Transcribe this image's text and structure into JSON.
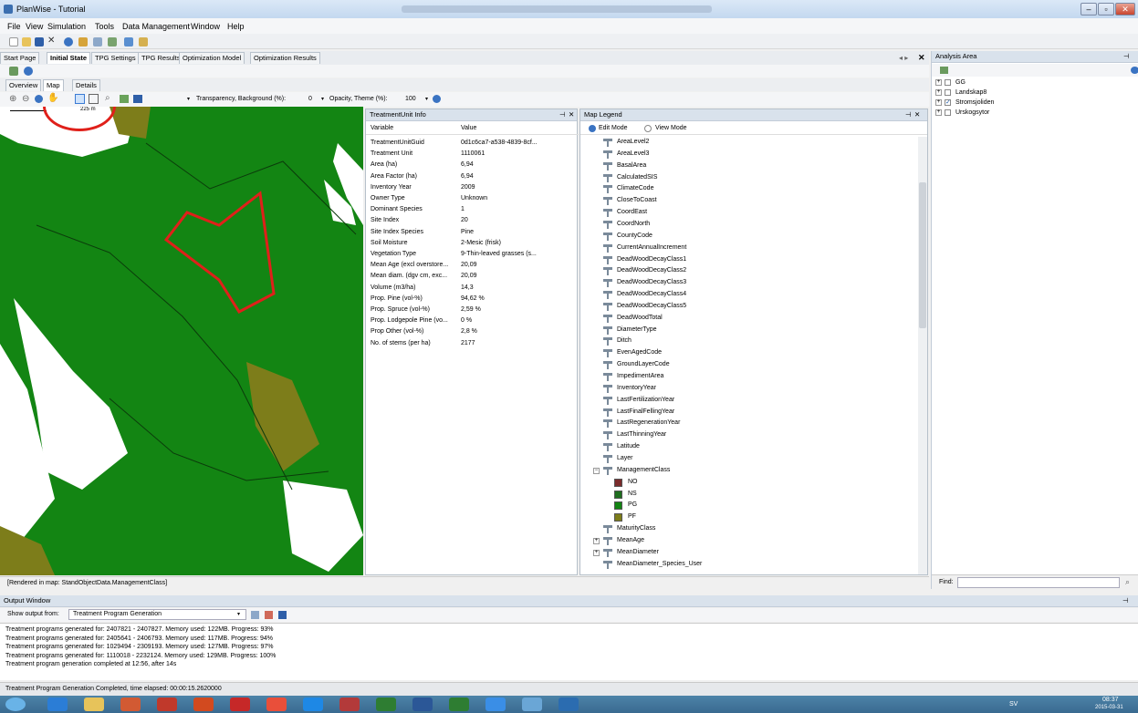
{
  "window": {
    "title": "PlanWise - Tutorial"
  },
  "menu": [
    "File",
    "View",
    "Simulation",
    "Tools",
    "Data Management",
    "Window",
    "Help"
  ],
  "doc_tabs": [
    {
      "label": "Start Page",
      "active": false
    },
    {
      "label": "Initial State",
      "active": true
    },
    {
      "label": "TPG Settings",
      "active": false
    },
    {
      "label": "TPG Results",
      "active": false
    },
    {
      "label": "Optimization Model",
      "active": false
    },
    {
      "label": "Optimization Results",
      "active": false
    }
  ],
  "view_tabs": [
    "Overview",
    "Map",
    "Details"
  ],
  "map_toolbar": {
    "transparency_label": "Transparency, Background (%):",
    "transparency_value": "0",
    "opacity_label": "Opacity, Theme (%):",
    "opacity_value": "100"
  },
  "scale_label": "225 m",
  "map_status": "[Rendered in map: StandObjectData.ManagementClass]",
  "treatment_unit_info": {
    "title": "TreatmentUnit Info",
    "col_variable": "Variable",
    "col_value": "Value",
    "rows": [
      {
        "variable": "TreatmentUnitGuid",
        "value": "0d1c6ca7-a538-4839-8cf..."
      },
      {
        "variable": "Treatment Unit",
        "value": "1110061"
      },
      {
        "variable": "Area (ha)",
        "value": "6,94"
      },
      {
        "variable": "Area Factor (ha)",
        "value": "6,94"
      },
      {
        "variable": "Inventory Year",
        "value": "2009"
      },
      {
        "variable": "Owner Type",
        "value": "Unknown"
      },
      {
        "variable": "Dominant Species",
        "value": "1"
      },
      {
        "variable": "Site Index",
        "value": "20"
      },
      {
        "variable": "Site Index Species",
        "value": "Pine"
      },
      {
        "variable": "Soil Moisture",
        "value": "2-Mesic (frisk)"
      },
      {
        "variable": "Vegetation Type",
        "value": "9-Thin-leaved grasses (s..."
      },
      {
        "variable": "Mean Age (excl overstore...",
        "value": "20,09"
      },
      {
        "variable": "Mean diam. (dgv cm, exc...",
        "value": "20,09"
      },
      {
        "variable": "Volume (m3/ha)",
        "value": "14,3"
      },
      {
        "variable": "Prop. Pine (vol-%)",
        "value": "94,62 %"
      },
      {
        "variable": "Prop. Spruce (vol-%)",
        "value": "2,59 %"
      },
      {
        "variable": "Prop. Lodgepole Pine (vo...",
        "value": "0 %"
      },
      {
        "variable": "Prop Other (vol-%)",
        "value": "2,8 %"
      },
      {
        "variable": "No. of stems (per ha)",
        "value": "2177"
      }
    ]
  },
  "map_legend": {
    "title": "Map Legend",
    "mode_edit": "Edit Mode",
    "mode_view": "View Mode",
    "items": [
      "AreaLevel2",
      "AreaLevel3",
      "BasalArea",
      "CalculatedSIS",
      "ClimateCode",
      "CloseToCoast",
      "CoordEast",
      "CoordNorth",
      "CountyCode",
      "CurrentAnnualIncrement",
      "DeadWoodDecayClass1",
      "DeadWoodDecayClass2",
      "DeadWoodDecayClass3",
      "DeadWoodDecayClass4",
      "DeadWoodDecayClass5",
      "DeadWoodTotal",
      "DiameterType",
      "Ditch",
      "EvenAgedCode",
      "GroundLayerCode",
      "ImpedimentArea",
      "InventoryYear",
      "LastFertilizationYear",
      "LastFinalFellingYear",
      "LastRegenerationYear",
      "LastThinningYear",
      "Latitude",
      "Layer",
      "ManagementClass",
      "NO",
      "NS",
      "PG",
      "PF",
      "MaturityClass",
      "MeanAge",
      "MeanDiameter",
      "MeanDiameter_Species_User"
    ],
    "management_classes": [
      {
        "label": "NO",
        "color": "#7b2c2c"
      },
      {
        "label": "NS",
        "color": "#1f6e1f"
      },
      {
        "label": "PG",
        "color": "#138513"
      },
      {
        "label": "PF",
        "color": "#7d7d1a"
      }
    ]
  },
  "analysis_area": {
    "title": "Analysis Area",
    "items": [
      {
        "label": "GG",
        "checked": false
      },
      {
        "label": "Landskap8",
        "checked": false
      },
      {
        "label": "Stromsjoliden",
        "checked": true
      },
      {
        "label": "Urskogsytor",
        "checked": false
      }
    ],
    "find_label": "Find:"
  },
  "output_window": {
    "title": "Output Window",
    "show_output_label": "Show output from:",
    "source": "Treatment Program Generation",
    "lines": [
      "Treatment programs generated for: 2407821 - 2407827. Memory used: 122MB. Progress: 93%",
      "Treatment programs generated for: 2405641 - 2406793. Memory used: 117MB. Progress: 94%",
      "Treatment programs generated for: 1029494 - 2309193. Memory used: 127MB. Progress: 97%",
      "Treatment programs generated for: 1110018 - 2232124. Memory used: 129MB. Progress: 100%",
      "Treatment program generation completed at 12:56, after 14s"
    ]
  },
  "status_bar": "Treatment Program Generation Completed, time elapsed: 00:00:15.2620000",
  "taskbar": {
    "lang": "SV",
    "time": "08:37",
    "date": "2015-03-31"
  },
  "colors": {
    "map_green": "#138513",
    "map_olive": "#7d7d1a",
    "highlight_red": "#e0201a"
  }
}
